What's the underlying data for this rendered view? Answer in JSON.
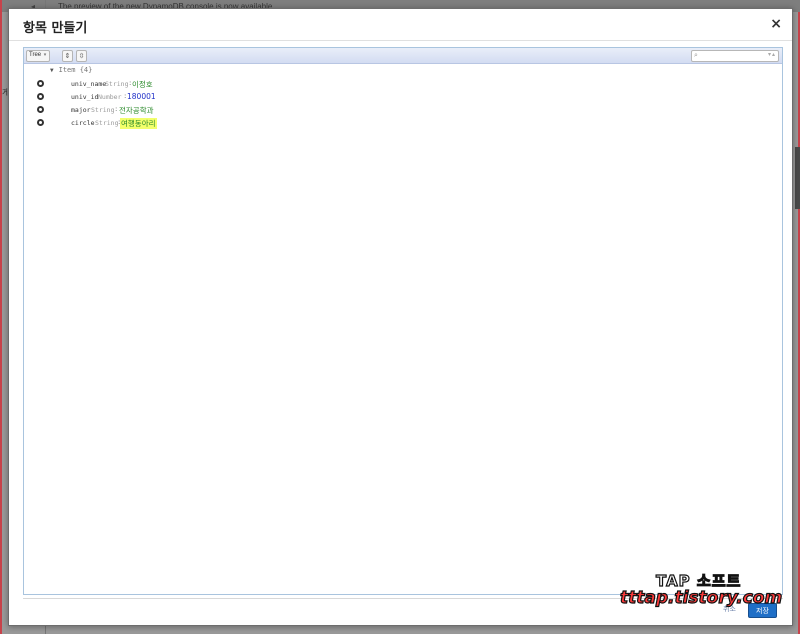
{
  "background": {
    "notice": "The preview of the new DynamoDB console is now available",
    "left_label": "게 !"
  },
  "modal": {
    "title": "항목 만들기",
    "close_glyph": "×"
  },
  "toolbar": {
    "mode_label": "Tree",
    "mode_caret": "▾",
    "expand_glyph": "⇕",
    "collapse_glyph": "⇳",
    "search_icon_glyph": "⌕",
    "search_arrows": "▾▴"
  },
  "tree": {
    "root_label": "Item {4}",
    "root_toggle": "▼",
    "items": [
      {
        "field": "univ_name",
        "type": "String",
        "value": "이정호",
        "value_kind": "string"
      },
      {
        "field": "univ_id",
        "type": "Number",
        "value": "180001",
        "value_kind": "number"
      },
      {
        "field": "major",
        "type": "String",
        "value": "전자공학과",
        "value_kind": "string"
      },
      {
        "field": "circle",
        "type": "String",
        "value": "여행동아리",
        "value_kind": "highlight"
      }
    ],
    "colon": ":"
  },
  "footer": {
    "cancel_label": "취소",
    "save_label": "저장"
  },
  "watermark": {
    "line1": "TAP 소프트",
    "line2": "tttap.tistory.com"
  },
  "colors": {
    "save_button": "#1f6fc7",
    "string_value": "#2a8a2a",
    "number_value": "#2030c8",
    "highlight": "#f2ff6c",
    "toolbar": "#d3dcf2"
  }
}
